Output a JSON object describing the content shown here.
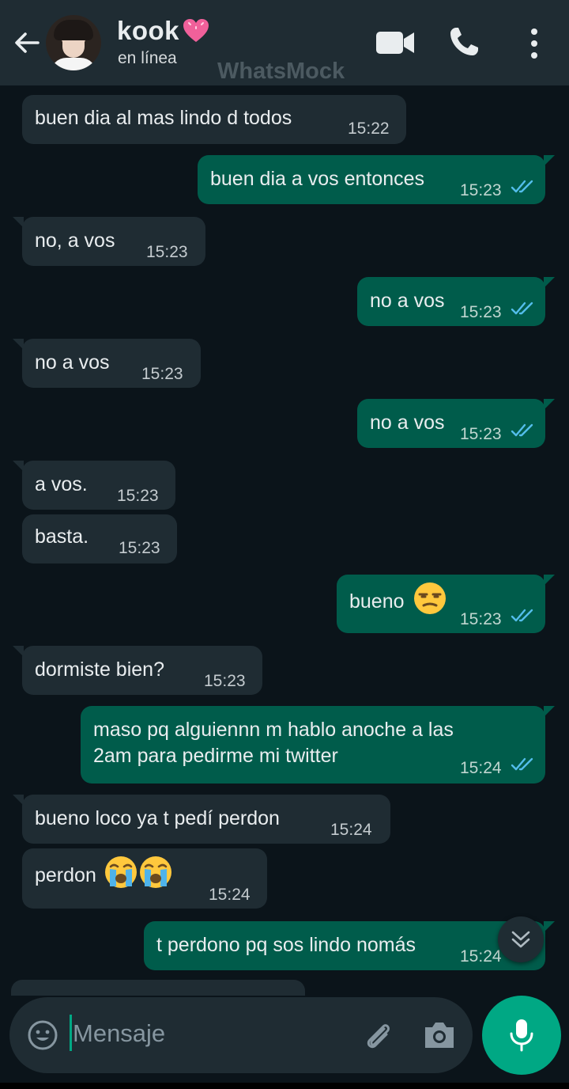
{
  "header": {
    "contact_name": "kook",
    "status": "en línea",
    "watermark": "WhatsMock",
    "icons": [
      "back-arrow-icon",
      "heart-emoji-icon",
      "video-call-icon",
      "phone-icon",
      "more-options-icon"
    ]
  },
  "messages": [
    {
      "dir": "in",
      "text": "buen dia al mas lindo d todos",
      "time": "15:22"
    },
    {
      "dir": "out",
      "text": "buen dia a vos entonces",
      "time": "15:23",
      "read": true
    },
    {
      "dir": "in",
      "text": "no, a vos",
      "time": "15:23"
    },
    {
      "dir": "out",
      "text": "no a vos",
      "time": "15:23",
      "read": true
    },
    {
      "dir": "in",
      "text": "no a vos",
      "time": "15:23"
    },
    {
      "dir": "out",
      "text": "no a vos",
      "time": "15:23",
      "read": true
    },
    {
      "dir": "in",
      "text": "a vos.",
      "time": "15:23"
    },
    {
      "dir": "in",
      "text": "basta.",
      "time": "15:23"
    },
    {
      "dir": "out",
      "text": "bueno",
      "emoji": "unamused-face",
      "time": "15:23",
      "read": true
    },
    {
      "dir": "in",
      "text": "dormiste bien?",
      "time": "15:23"
    },
    {
      "dir": "out",
      "text_line1": "maso pq alguiennn m hablo anoche a las",
      "text_line2": "2am para pedirme mi twitter",
      "time": "15:24",
      "read": true
    },
    {
      "dir": "in",
      "text": "bueno loco ya t pedí perdon",
      "time": "15:24"
    },
    {
      "dir": "in",
      "text": "perdon",
      "emoji": "loudly-crying-face x2",
      "time": "15:24"
    },
    {
      "dir": "out",
      "text": "t perdono pq sos lindo nomás",
      "time": "15:24",
      "read": true
    }
  ],
  "input": {
    "placeholder": "Mensaje"
  },
  "colors": {
    "background": "#0b141a",
    "header": "#1f2c33",
    "incoming_bubble": "#1f2c33",
    "outgoing_bubble": "#005c4b",
    "accent": "#00a884",
    "read_ticks": "#53bdeb"
  }
}
